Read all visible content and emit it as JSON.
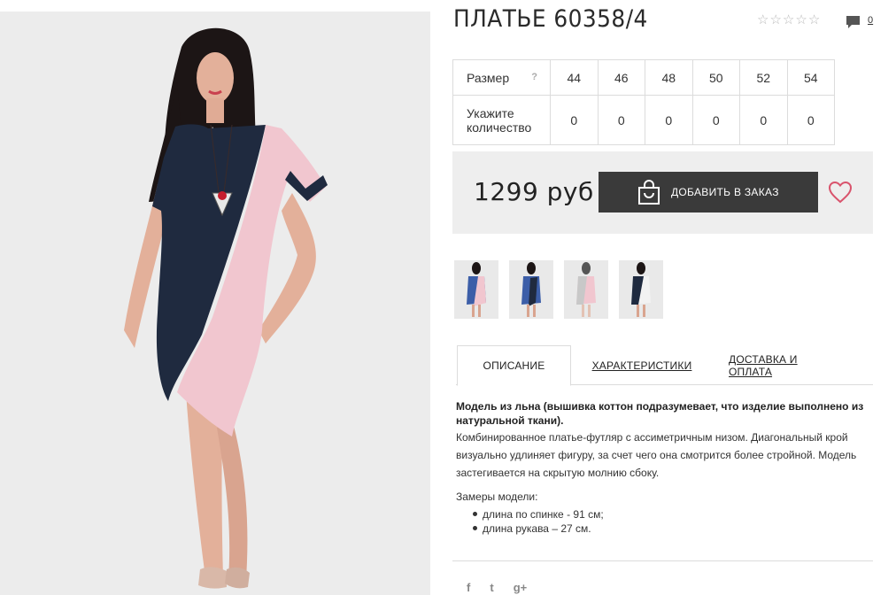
{
  "product": {
    "title": "ПЛАТЬЕ 60358/4",
    "rating_icon": "star-outline-icon",
    "comments_count": "0"
  },
  "sizes": {
    "size_label": "Размер",
    "help_mark": "?",
    "quantity_label": "Укажите количество",
    "values": [
      "44",
      "46",
      "48",
      "50",
      "52",
      "54"
    ],
    "quantities": [
      "0",
      "0",
      "0",
      "0",
      "0",
      "0"
    ]
  },
  "buy": {
    "price": "1299 руб",
    "add_button_label": "ДОБАВИТЬ В ЗАКАЗ",
    "accent": "#d9536c",
    "button_color": "#3a3a3a"
  },
  "tabs": {
    "description": "ОПИСАНИЕ",
    "characteristics": "ХАРАКТЕРИСТИКИ",
    "delivery": "ДОСТАВКА И ОПЛАТА"
  },
  "description": {
    "bold": "Модель из льна (вышивка коттон подразумевает, что изделие выполнено из натуральной ткани).",
    "text": "Комбинированное платье-футляр с ассиметричным низом. Диагональный крой визуально удлиняет фигуру, за счет чего она смотрится более стройной. Модель застегивается на скрытую молнию сбоку.",
    "measurements_title": "Замеры модели:",
    "measurements": [
      "длина по спинке - 91 см;",
      "длина рукава – 27 см."
    ]
  },
  "social": [
    "f",
    "t",
    "g+"
  ],
  "colors": {
    "navy": "#1f2a3f",
    "pink": "#f1c6cf",
    "blue": "#3c5ea8"
  }
}
